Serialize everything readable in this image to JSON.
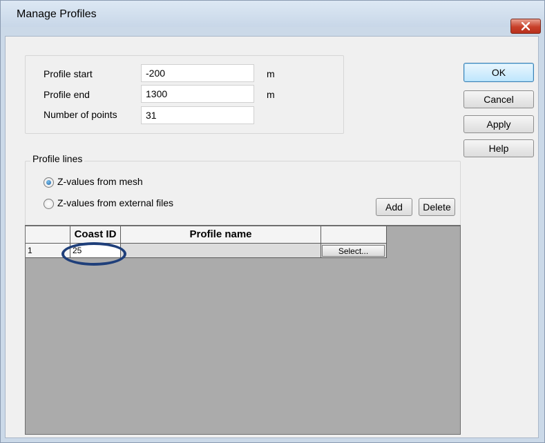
{
  "window": {
    "title": "Manage Profiles",
    "close_icon": "close-icon"
  },
  "profile": {
    "start_label": "Profile start",
    "start_value": "-200",
    "start_unit": "m",
    "end_label": "Profile end",
    "end_value": "1300",
    "end_unit": "m",
    "points_label": "Number of points",
    "points_value": "31"
  },
  "buttons": {
    "ok": "OK",
    "cancel": "Cancel",
    "apply": "Apply",
    "help": "Help"
  },
  "profile_lines": {
    "group_label": "Profile lines",
    "radio_mesh": "Z-values from mesh",
    "radio_external": "Z-values from external files",
    "selected": "Z-values from mesh",
    "add": "Add",
    "delete": "Delete"
  },
  "grid": {
    "columns": [
      "",
      "Coast ID",
      "Profile name",
      ""
    ],
    "rows": [
      {
        "index": "1",
        "coast_id": "25",
        "profile_name": "",
        "action": "Select..."
      }
    ]
  },
  "colors": {
    "highlight_ellipse": "#1f3f7a",
    "close_button": "#c8402a"
  }
}
